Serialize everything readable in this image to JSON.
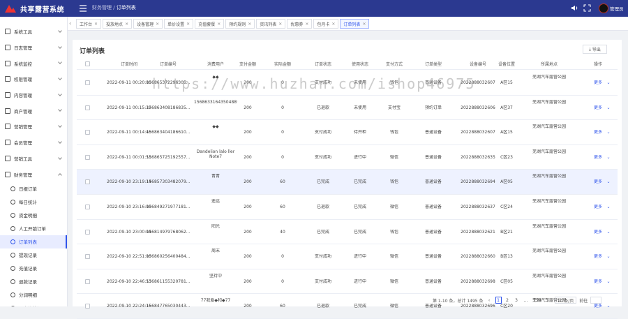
{
  "app_title": "共享露营系统",
  "breadcrumb": {
    "parent": "财务管理",
    "sep": " / ",
    "current": "订单列表"
  },
  "user": {
    "name": "管理员"
  },
  "sidebar": {
    "items": [
      {
        "label": "系统工具",
        "icon": "tool-icon"
      },
      {
        "label": "日志管理",
        "icon": "log-icon"
      },
      {
        "label": "系统监控",
        "icon": "monitor-icon"
      },
      {
        "label": "权限管理",
        "icon": "lock-icon"
      },
      {
        "label": "内容管理",
        "icon": "content-icon"
      },
      {
        "label": "商户管理",
        "icon": "merchant-icon"
      },
      {
        "label": "营销管理",
        "icon": "marketing-icon"
      },
      {
        "label": "会员管理",
        "icon": "member-icon"
      },
      {
        "label": "营销工具",
        "icon": "cart-icon"
      },
      {
        "label": "财务管理",
        "icon": "finance-icon"
      }
    ],
    "subitems": [
      {
        "label": "日报订单",
        "icon": "clock-icon"
      },
      {
        "label": "每日统计",
        "icon": "chart-icon"
      },
      {
        "label": "资金明细",
        "icon": "detail-icon"
      },
      {
        "label": "人工开锁订单",
        "icon": "person-icon"
      },
      {
        "label": "订单列表",
        "icon": "order-icon"
      },
      {
        "label": "提现记录",
        "icon": "withdraw-icon"
      },
      {
        "label": "充值记录",
        "icon": "recharge-icon"
      },
      {
        "label": "退款记录",
        "icon": "refund-icon"
      },
      {
        "label": "分润明细",
        "icon": "share-icon"
      },
      {
        "label": "用户帐的记录",
        "icon": "record-icon"
      }
    ]
  },
  "tabs": [
    "工作台",
    "投放地点",
    "设备管理",
    "单价设置",
    "充值套餐",
    "预约规则",
    "资讯列表",
    "优惠券",
    "包月卡",
    "订单列表"
  ],
  "panel": {
    "title": "订单列表",
    "export_label": "导出"
  },
  "table": {
    "columns": [
      "订单时间",
      "订单编号",
      "消费用户",
      "支付金额",
      "实际金额",
      "订单状态",
      "使用状态",
      "支付方式",
      "订单类型",
      "设备编号",
      "设备位置",
      "所属地点",
      "操作"
    ],
    "rows": [
      [
        "2022-09-11 00:20:00",
        "156865372296305...",
        "◆◆",
        "200",
        "0",
        "支付成功",
        "未使用",
        "钱包",
        "普通设备",
        "2022888032607",
        "A区15",
        "芜湖汽车露营公园",
        "更多"
      ],
      [
        "2022-09-11 00:15:37",
        "156863408186835...",
        "1568633164350488912",
        "200",
        "0",
        "已退款",
        "未使用",
        "支付宝",
        "预约订单",
        "2022888032606",
        "A区37",
        "芜湖汽车露营公园",
        "更多"
      ],
      [
        "2022-09-11 00:14:46",
        "156863404186610...",
        "◆◆",
        "200",
        "0",
        "支付成功",
        "待开柜",
        "钱包",
        "普通设备",
        "2022888032607",
        "A区15",
        "芜湖汽车露营公园",
        "更多"
      ],
      [
        "2022-09-11 00:01:51",
        "156865725192557...",
        "Dandelion lalo ller Note7",
        "200",
        "0",
        "支付成功",
        "进行中",
        "微信",
        "普通设备",
        "2022888032635",
        "C区23",
        "芜湖汽车露营公园",
        "更多"
      ],
      [
        "2022-09-10 23:19:14",
        "156857303482079...",
        "青青",
        "200",
        "60",
        "已完成",
        "已完成",
        "钱包",
        "普通设备",
        "2022888032694",
        "A区05",
        "芜湖汽车露营公园",
        "更多"
      ],
      [
        "2022-09-10 23:16:00",
        "156849271977181...",
        "遥远",
        "200",
        "60",
        "已退款",
        "已完成",
        "微信",
        "普通设备",
        "2022888032637",
        "C区24",
        "芜湖汽车露营公园",
        "更多"
      ],
      [
        "2022-09-10 23:00:04",
        "156814979768062...",
        "阳光",
        "200",
        "40",
        "已完成",
        "已完成",
        "钱包",
        "普通设备",
        "2022888032621",
        "B区21",
        "芜湖汽车露营公园",
        "更多"
      ],
      [
        "2022-09-10 22:51:00",
        "156860256400484...",
        "周末",
        "200",
        "0",
        "支付成功",
        "进行中",
        "微信",
        "普通设备",
        "2022888032660",
        "B区13",
        "芜湖汽车露营公园",
        "更多"
      ],
      [
        "2022-09-10 22:46:53",
        "156861155320781...",
        "坚持中",
        "200",
        "0",
        "支付成功",
        "进行中",
        "微信",
        "普通设备",
        "2022888032698",
        "C区05",
        "芜湖汽车露营公园",
        "更多"
      ],
      [
        "2022-09-10 22:24:16",
        "156847765030443...",
        "77我爱◆和◆77",
        "200",
        "60",
        "已退款",
        "已完成",
        "微信",
        "普通设备",
        "2022888032696",
        "C区20",
        "芜湖汽车露营公园",
        "更多"
      ]
    ]
  },
  "pagination": {
    "summary": "第 1-10 条，总计 1495 条",
    "pages": [
      "1",
      "2",
      "3",
      "...",
      "150"
    ],
    "page_size": "10 条/页",
    "jump_label": "前往"
  },
  "watermark": "https://www.huzhan.com/ishop46975",
  "colors": {
    "topbar": "#2b3990",
    "accent": "#2f54eb",
    "highlight_row": "#eef2ff"
  }
}
